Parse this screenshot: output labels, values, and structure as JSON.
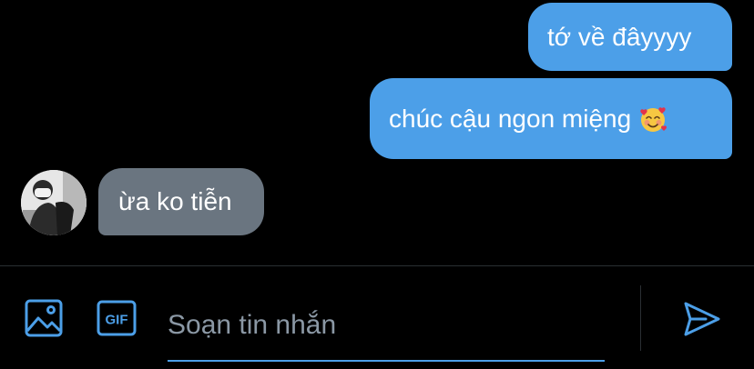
{
  "messages": [
    {
      "direction": "sent",
      "text": "tớ về đâyyyy"
    },
    {
      "direction": "sent",
      "text": "chúc cậu ngon miệng",
      "emoji": "smiling-face-with-hearts"
    },
    {
      "direction": "received",
      "text": "ừa ko tiễn"
    }
  ],
  "composer": {
    "placeholder": "Soạn tin nhắn",
    "value": "",
    "gif_label": "GIF",
    "image_icon": "image-icon",
    "send_icon": "send-icon"
  },
  "colors": {
    "sent_bubble": "#4c9fe8",
    "received_bubble": "#6a7580",
    "accent": "#4c9fe8",
    "background": "#000000",
    "placeholder": "#8b98a5"
  }
}
